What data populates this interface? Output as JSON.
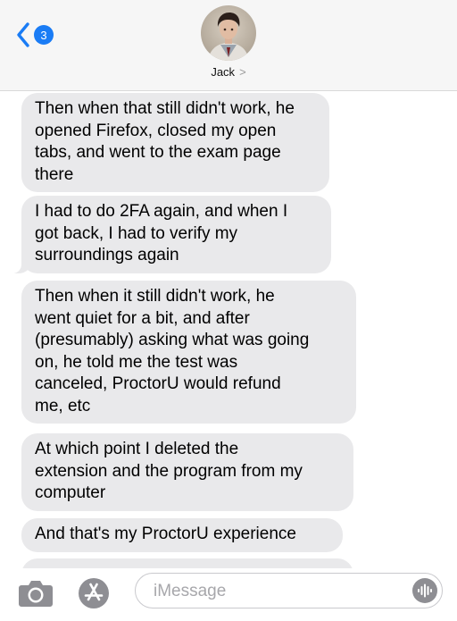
{
  "header": {
    "back_badge": "3",
    "contact_name": "Jack",
    "contact_chevron": ">"
  },
  "messages": [
    {
      "lines": [
        "Then when that still didn't work, he",
        "opened Firefox, closed my open",
        "tabs, and went to the exam page",
        "there"
      ]
    },
    {
      "lines": [
        "I had to do 2FA again, and when I",
        "got back, I had to verify my",
        "surroundings again"
      ]
    },
    {
      "lines": [
        "Then when it still didn't work, he",
        "went quiet for a bit, and after",
        "(presumably) asking what was going",
        "on, he told me the test was",
        "canceled, ProctorU would refund",
        "me, etc"
      ]
    },
    {
      "lines": [
        "At which point I deleted the",
        "extension and the program from my",
        "computer"
      ]
    },
    {
      "lines": [
        "And that's my ProctorU experience"
      ]
    }
  ],
  "input": {
    "placeholder": "iMessage"
  },
  "colors": {
    "accent": "#1a7cf5",
    "bubble_received": "#e9e9eb",
    "header_bg": "#f6f6f6",
    "icon_gray": "#8e8e93"
  },
  "icons": [
    "chevron-left-icon",
    "camera-icon",
    "app-store-icon",
    "audio-waveform-icon"
  ]
}
